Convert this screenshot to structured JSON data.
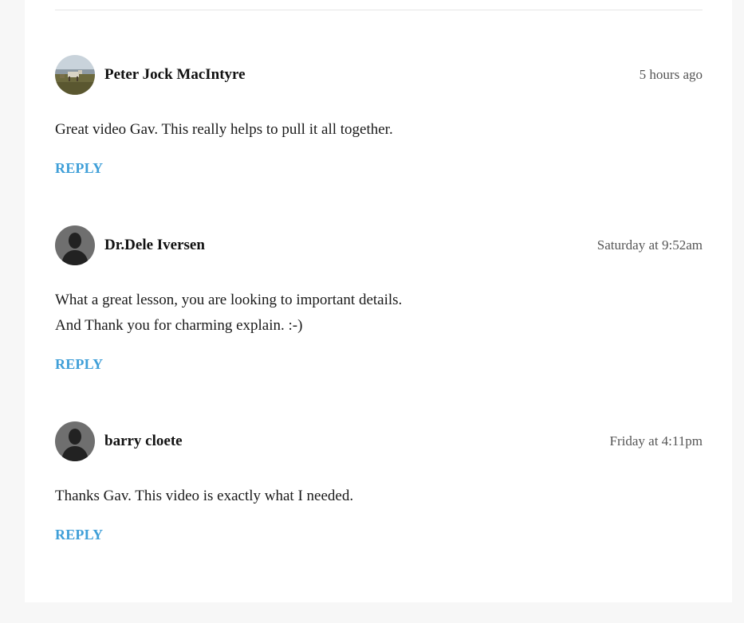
{
  "comments": [
    {
      "author": "Peter Jock MacIntyre",
      "time": "5 hours ago",
      "avatar": "photo-avatar",
      "lines": [
        "Great video Gav. This really helps to pull it all together."
      ],
      "reply_label": "REPLY"
    },
    {
      "author": "Dr.Dele Iversen",
      "time": "Saturday at 9:52am",
      "avatar": "default-user-avatar",
      "lines": [
        "What a great lesson, you are looking to important details.",
        "And Thank you for charming explain. :-)"
      ],
      "reply_label": "REPLY"
    },
    {
      "author": "barry cloete",
      "time": "Friday at 4:11pm",
      "avatar": "default-user-avatar",
      "lines": [
        "Thanks Gav. This video is exactly what I needed."
      ],
      "reply_label": "REPLY"
    }
  ],
  "colors": {
    "reply_link": "#3f9fd8",
    "page_background": "#f7f7f7",
    "card_background": "#ffffff"
  }
}
